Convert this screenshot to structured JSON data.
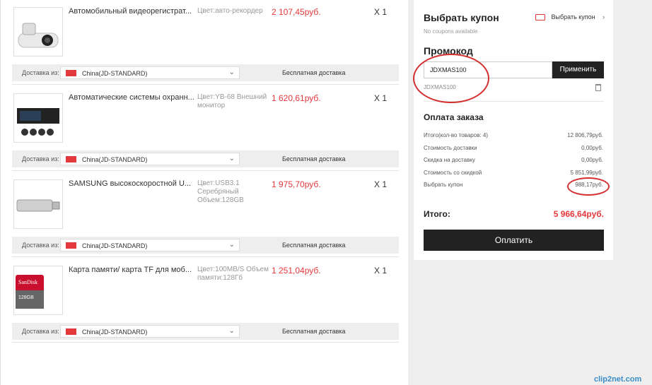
{
  "items": [
    {
      "title": "Автомобильный видеорегистрат...",
      "variant": "Цвет:авто-рекордер",
      "price": "2 107,45руб.",
      "qty": "X 1"
    },
    {
      "title": "Автоматические системы охранн...",
      "variant": "Цвет:YB-68 Внешний монитор",
      "price": "1 620,61руб.",
      "qty": "X 1"
    },
    {
      "title": "SAMSUNG высокоскоростной U...",
      "variant": "Цвет:USB3.1 Серебряный Объем:128GB",
      "price": "1 975,70руб.",
      "qty": "X 1"
    },
    {
      "title": "Карта памяти/ карта TF для моб...",
      "variant": "Цвет:100MB/S Объем памяти:128Гб",
      "price": "1 251,04руб.",
      "qty": "X 1"
    }
  ],
  "shipping": {
    "from_label": "Доставка из:",
    "method": "China(JD-STANDARD)",
    "free_label": "Бесплатная доставка"
  },
  "coupon": {
    "title": "Выбрать купон",
    "link": "Выбрать купон",
    "none": "No coupons available"
  },
  "promo": {
    "title": "Промокод",
    "input_value": "JDXMAS100",
    "apply": "Применить",
    "applied": "JDXMAS100"
  },
  "payment": {
    "title": "Оплата заказа",
    "rows": [
      {
        "label": "Итого(кол-во товаров: 4)",
        "value": "12 806,79руб."
      },
      {
        "label": "Стоимость доставки",
        "value": "0,00руб."
      },
      {
        "label": "Скидка на доставку",
        "value": "0,00руб."
      },
      {
        "label": "Стоимость со скидкой",
        "value": "5 851,99руб."
      },
      {
        "label": "Выбрать купон",
        "value": "988,17руб."
      }
    ]
  },
  "total": {
    "label": "Итого:",
    "value": "5 966,64руб.",
    "pay": "Оплатить"
  },
  "watermark": "clip2net.com",
  "colors": {
    "accent": "#e4393c",
    "dark": "#222222",
    "annotation": "#d32f2f"
  }
}
